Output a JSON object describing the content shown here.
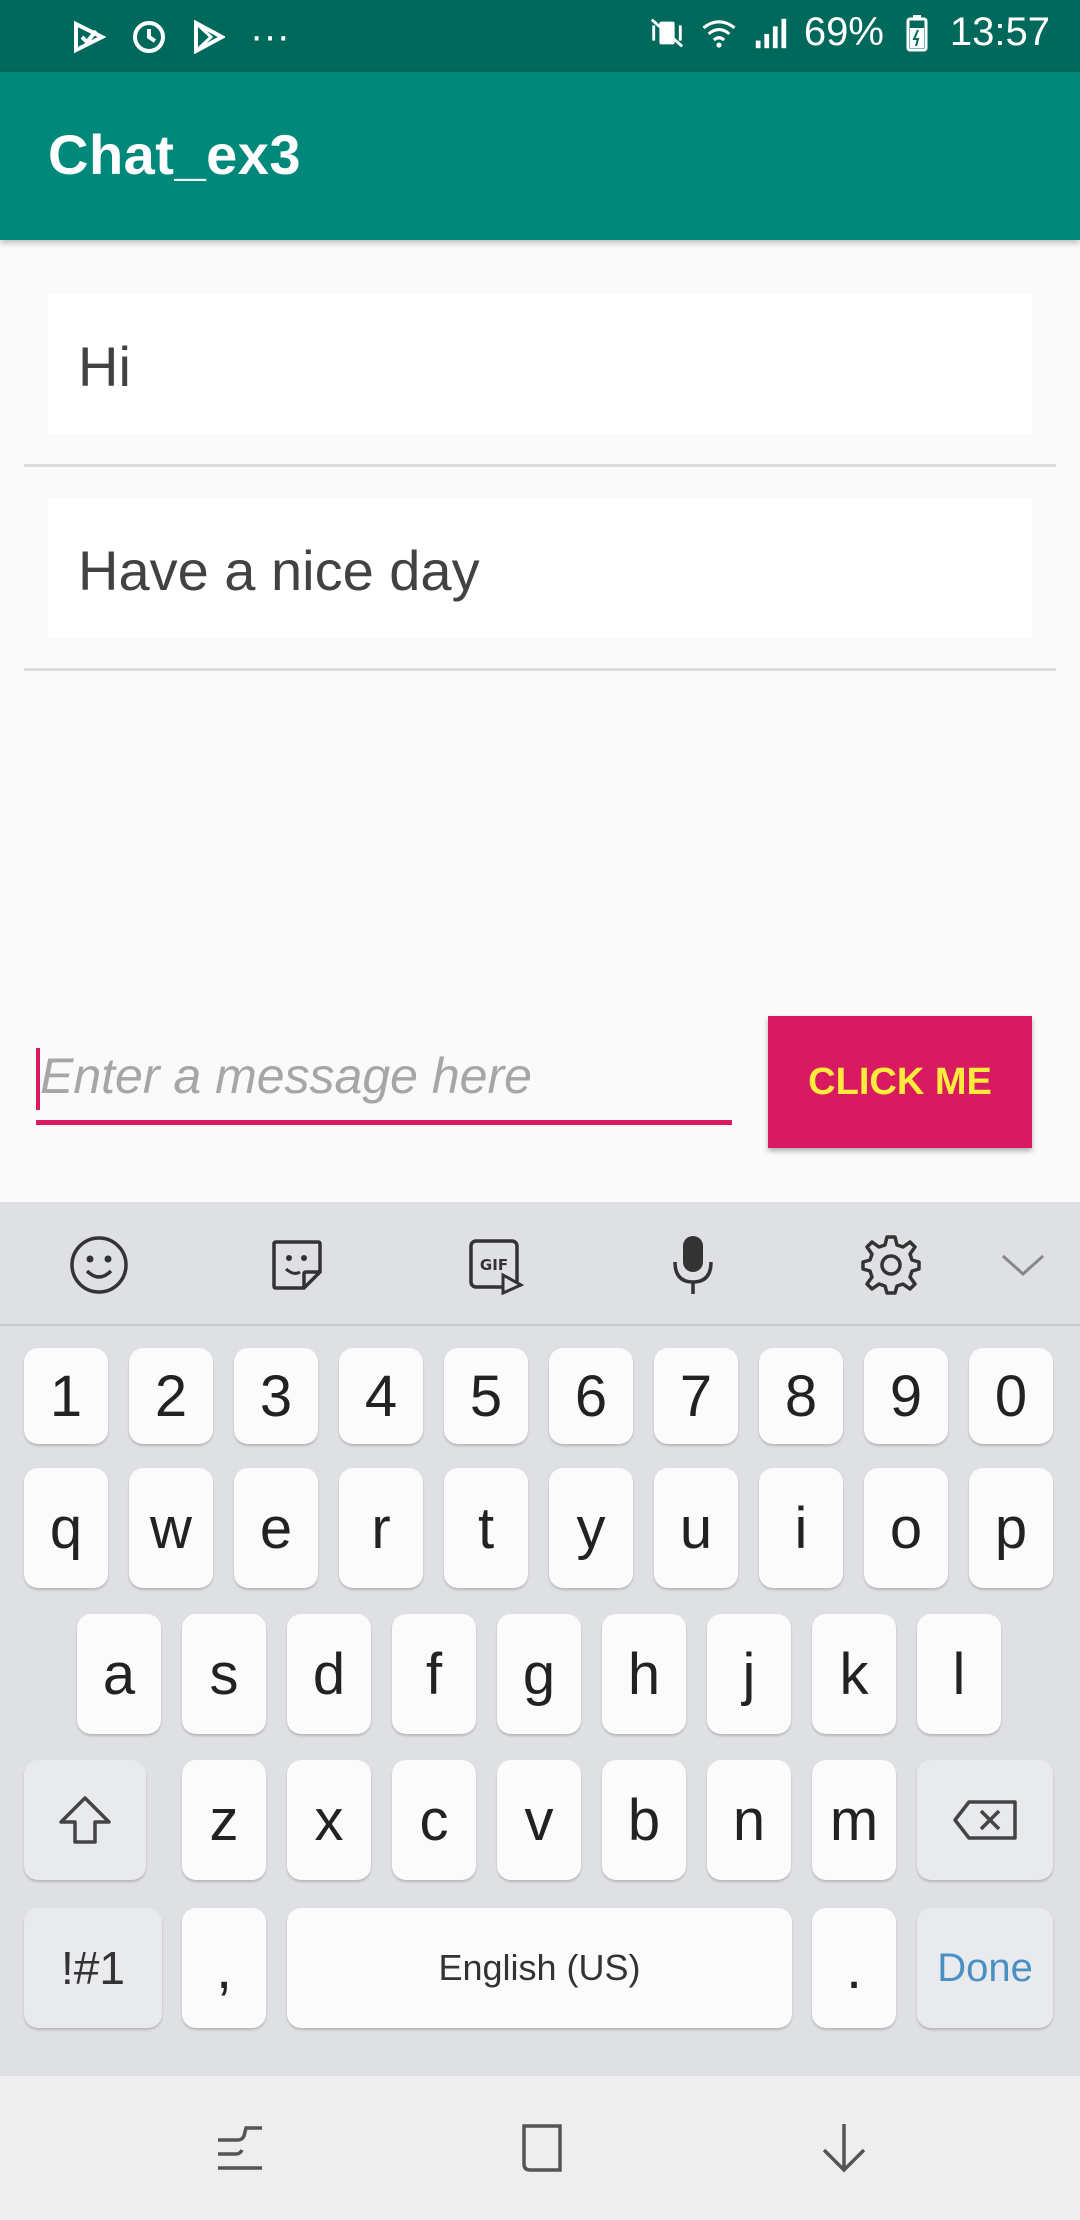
{
  "status_bar": {
    "battery": "69%",
    "time": "13:57",
    "more": "···"
  },
  "app": {
    "title": "Chat_ex3"
  },
  "messages": [
    {
      "text": "Hi"
    },
    {
      "text": "Have a nice day"
    }
  ],
  "composer": {
    "placeholder": "Enter a message here",
    "value": "",
    "button_label": "CLICK ME"
  },
  "keyboard": {
    "number_row": [
      "1",
      "2",
      "3",
      "4",
      "5",
      "6",
      "7",
      "8",
      "9",
      "0"
    ],
    "row1": [
      "q",
      "w",
      "e",
      "r",
      "t",
      "y",
      "u",
      "i",
      "o",
      "p"
    ],
    "row2": [
      "a",
      "s",
      "d",
      "f",
      "g",
      "h",
      "j",
      "k",
      "l"
    ],
    "row3": [
      "z",
      "x",
      "c",
      "v",
      "b",
      "n",
      "m"
    ],
    "symbols_label": "!#1",
    "comma_label": ",",
    "space_label": "English (US)",
    "period_label": ".",
    "done_label": "Done"
  },
  "colors": {
    "status_bar": "#00695c",
    "app_bar": "#00897b",
    "accent": "#d81b60",
    "button_text": "#ffeb3b"
  }
}
